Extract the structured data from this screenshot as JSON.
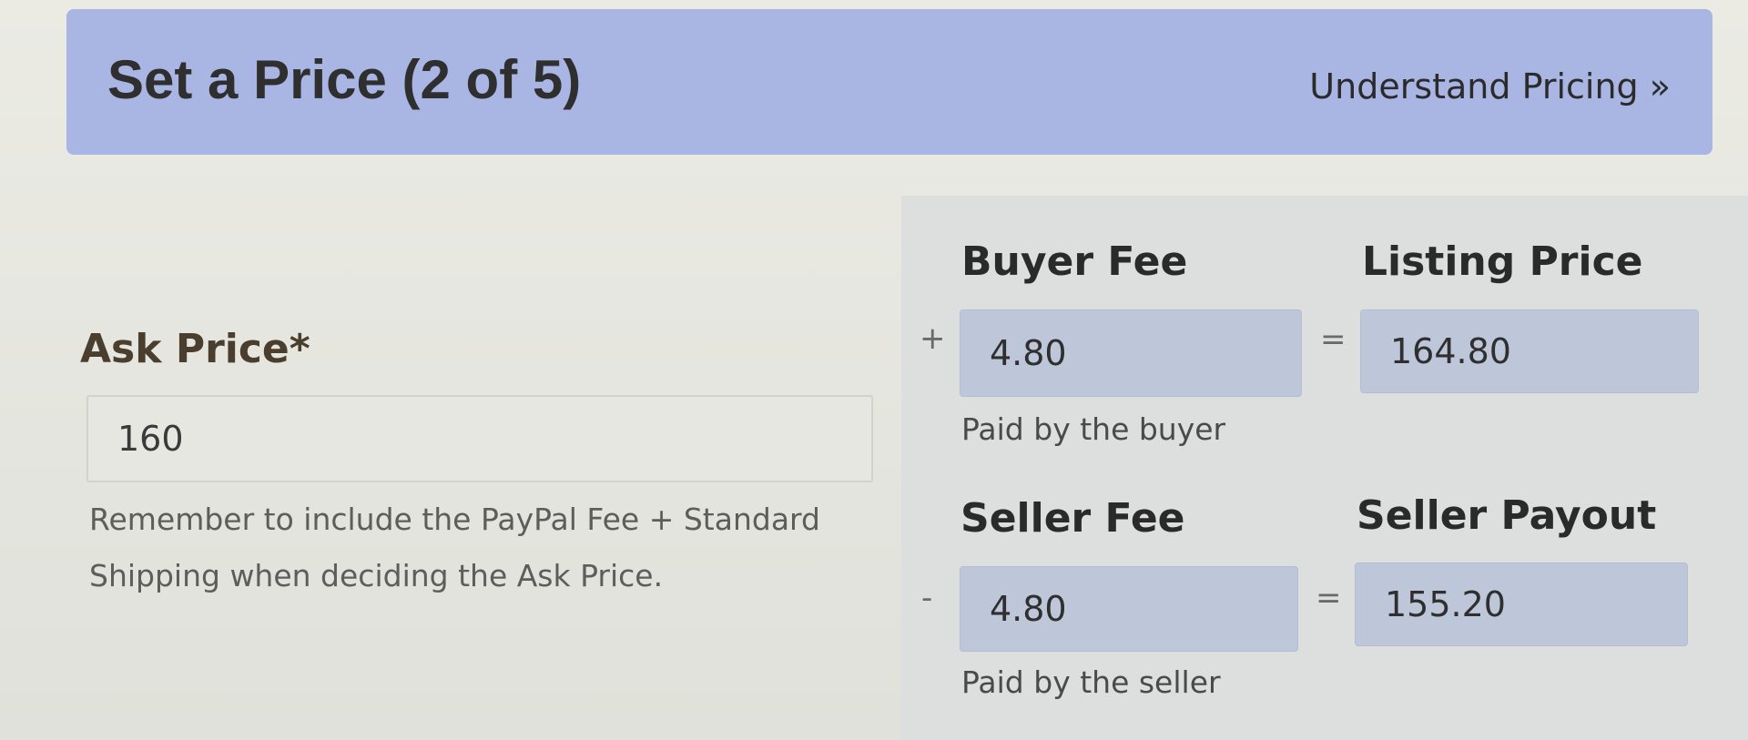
{
  "header": {
    "title": "Set a Price (2 of 5)",
    "link_label": "Understand Pricing »"
  },
  "ask_price": {
    "label": "Ask Price*",
    "value": "160",
    "helper": "Remember to include the PayPal Fee + Standard Shipping when deciding the Ask Price."
  },
  "buyer_fee": {
    "operator": "+",
    "label": "Buyer Fee",
    "value": "4.80",
    "note": "Paid by the buyer"
  },
  "listing_price": {
    "operator": "=",
    "label": "Listing Price",
    "value": "164.80"
  },
  "seller_fee": {
    "operator": "-",
    "label": "Seller Fee",
    "value": "4.80",
    "note": "Paid by the seller"
  },
  "seller_payout": {
    "operator": "=",
    "label": "Seller Payout",
    "value": "155.20"
  },
  "colors": {
    "header_bg": "#a9b5e3",
    "field_bg": "#bec6da",
    "page_bg": "#e6e6df"
  }
}
